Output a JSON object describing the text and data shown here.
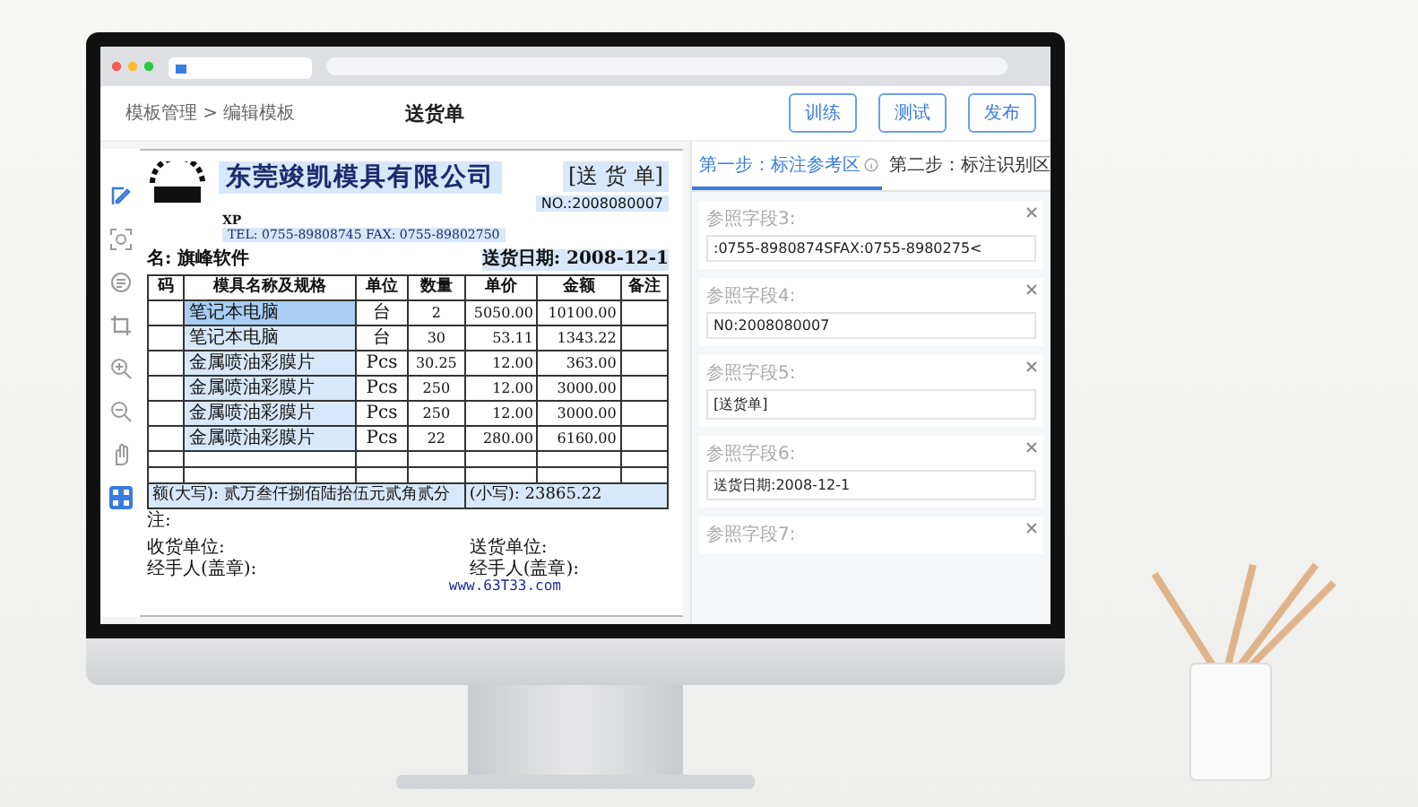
{
  "header": {
    "breadcrumb": "模板管理 > 编辑模板",
    "title": "送货单",
    "buttons": [
      "训练",
      "测试",
      "发布"
    ]
  },
  "toolbar": {
    "tools": [
      {
        "kind": "edit",
        "selected": false
      },
      {
        "kind": "scan",
        "selected": false
      },
      {
        "kind": "stamp",
        "selected": false
      },
      {
        "kind": "crop",
        "selected": false
      },
      {
        "kind": "zoom-in",
        "selected": false
      },
      {
        "kind": "zoom-out",
        "selected": false
      },
      {
        "kind": "hand",
        "selected": false
      },
      {
        "kind": "grid",
        "selected": true
      }
    ]
  },
  "document": {
    "company": "东莞竣凯模具有限公司",
    "doc_type": "[送 货 单]",
    "number": "NO.:2008080007",
    "code": "XP",
    "contact": "TEL: 0755-89808745  FAX: 0755-89802750",
    "customer": "名: 旗峰软件",
    "date": "送货日期: 2008-12-1",
    "columns": [
      "码",
      "模具名称及规格",
      "单位",
      "数量",
      "单价",
      "金额",
      "备注"
    ],
    "rows": [
      {
        "name": "笔记本电脑",
        "unit": "台",
        "qty": "2",
        "price": "5050.00",
        "amount": "10100.00",
        "selected": true
      },
      {
        "name": "笔记本电脑",
        "unit": "台",
        "qty": "30",
        "price": "53.11",
        "amount": "1343.22",
        "selected": false
      },
      {
        "name": "金属喷油彩膜片",
        "unit": "Pcs",
        "qty": "30.25",
        "price": "12.00",
        "amount": "363.00",
        "selected": false
      },
      {
        "name": "金属喷油彩膜片",
        "unit": "Pcs",
        "qty": "250",
        "price": "12.00",
        "amount": "3000.00",
        "selected": false
      },
      {
        "name": "金属喷油彩膜片",
        "unit": "Pcs",
        "qty": "250",
        "price": "12.00",
        "amount": "3000.00",
        "selected": false
      },
      {
        "name": "金属喷油彩膜片",
        "unit": "Pcs",
        "qty": "22",
        "price": "280.00",
        "amount": "6160.00",
        "selected": false
      }
    ],
    "total_words": "额(大写): 贰万叁仟捌佰陆拾伍元贰角贰分",
    "total_figures": "(小写): 23865.22",
    "remark": "注:",
    "signatures": [
      {
        "party": "收货单位:",
        "handler": "经手人(盖章):"
      },
      {
        "party": "送货单位:",
        "handler": "经手人(盖章):"
      }
    ],
    "website": "www.63T33.com"
  },
  "panel": {
    "tabs": [
      {
        "label": "第一步：标注参考区",
        "selected": true
      },
      {
        "label": "第二步：标注识别区",
        "selected": false
      }
    ],
    "fields": [
      {
        "label": "参照字段3:",
        "value": ":0755-8980874SFAX:0755-8980275<"
      },
      {
        "label": "参照字段4:",
        "value": "N0:2008080007"
      },
      {
        "label": "参照字段5:",
        "value": "[送货单]"
      },
      {
        "label": "参照字段6:",
        "value": "送货日期:2008-12-1"
      },
      {
        "label": "参照字段7:"
      }
    ]
  }
}
